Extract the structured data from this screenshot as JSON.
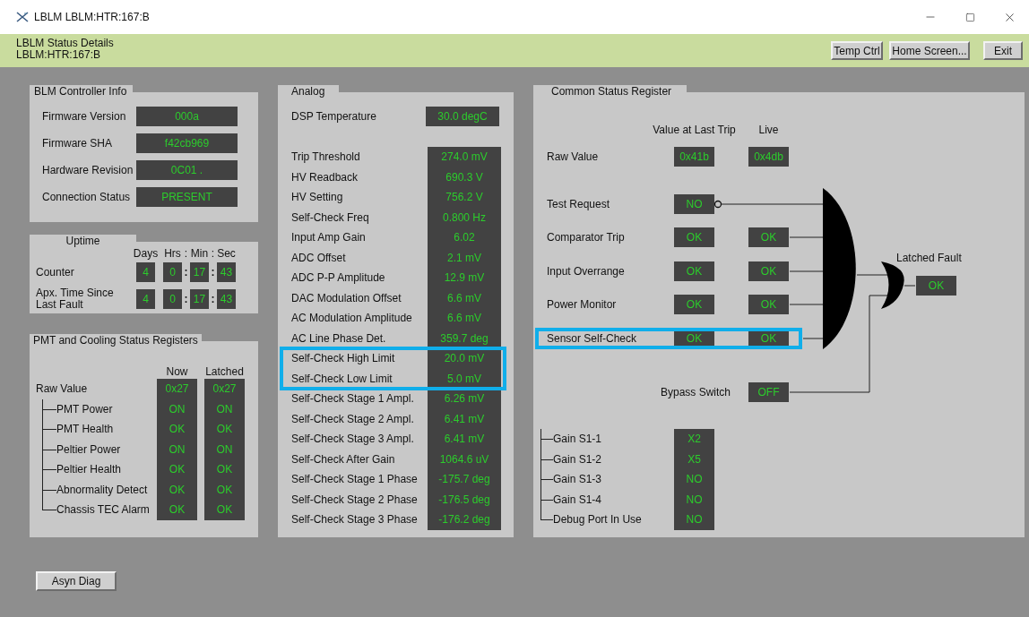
{
  "window": {
    "title": "LBLM LBLM:HTR:167:B"
  },
  "header": {
    "title": "LBLM Status Details",
    "subtitle": "LBLM:HTR:167:B",
    "buttons": [
      "Temp Ctrl",
      "Home Screen...",
      "Exit"
    ]
  },
  "controller_info": {
    "title": "BLM Controller Info",
    "fields": [
      {
        "label": "Firmware Version",
        "value": "000a"
      },
      {
        "label": "Firmware SHA",
        "value": "f42cb969"
      },
      {
        "label": "Hardware Revision",
        "value": "0C01 ."
      },
      {
        "label": "Connection Status",
        "value": "PRESENT"
      }
    ]
  },
  "uptime": {
    "title": "Uptime",
    "columns": [
      {
        "kind": "value",
        "text": "Days"
      },
      {
        "kind": "value",
        "text": "Hrs"
      },
      {
        "kind": "sep",
        "text": ":"
      },
      {
        "kind": "value",
        "text": "Min"
      },
      {
        "kind": "sep",
        "text": ":"
      },
      {
        "kind": "value",
        "text": "Sec"
      }
    ],
    "rows": [
      {
        "label": "Counter",
        "cells": [
          {
            "kind": "value",
            "text": "4"
          },
          {
            "kind": "value",
            "text": "0"
          },
          {
            "kind": "sep",
            "text": ":"
          },
          {
            "kind": "value",
            "text": "17"
          },
          {
            "kind": "sep",
            "text": ":"
          },
          {
            "kind": "value",
            "text": "43"
          }
        ]
      },
      {
        "label": "Apx. Time Since Last Fault",
        "cells": [
          {
            "kind": "value",
            "text": "4"
          },
          {
            "kind": "value",
            "text": "0"
          },
          {
            "kind": "sep",
            "text": ":"
          },
          {
            "kind": "value",
            "text": "17"
          },
          {
            "kind": "sep",
            "text": ":"
          },
          {
            "kind": "value",
            "text": "43"
          }
        ]
      }
    ]
  },
  "pmt": {
    "title": "PMT and Cooling Status Registers",
    "columns": [
      "Now",
      "Latched"
    ],
    "rows": [
      {
        "label": "Raw Value",
        "now": "0x27",
        "latched": "0x27",
        "children": [
          {
            "label": "PMT Power",
            "now": "ON",
            "latched": "ON"
          },
          {
            "label": "PMT Health",
            "now": "OK",
            "latched": "OK"
          },
          {
            "label": "Peltier Power",
            "now": "ON",
            "latched": "ON"
          },
          {
            "label": "Peltier Health",
            "now": "OK",
            "latched": "OK"
          },
          {
            "label": "Abnormality Detect",
            "now": "OK",
            "latched": "OK"
          },
          {
            "label": "Chassis TEC Alarm",
            "now": "OK",
            "latched": "OK"
          }
        ]
      }
    ]
  },
  "analog": {
    "title": "Analog",
    "dsp": {
      "label": "DSP Temperature",
      "value": "30.0 degC"
    },
    "rows": [
      {
        "label": "Trip Threshold",
        "value": "274.0 mV",
        "highlighted": false
      },
      {
        "label": "HV Readback",
        "value": "690.3 V",
        "highlighted": false
      },
      {
        "label": "HV Setting",
        "value": "756.2 V",
        "highlighted": false
      },
      {
        "label": "Self-Check Freq",
        "value": "0.800 Hz",
        "highlighted": false
      },
      {
        "label": "Input Amp Gain",
        "value": "6.02",
        "highlighted": false
      },
      {
        "label": "ADC Offset",
        "value": "2.1 mV",
        "highlighted": false
      },
      {
        "label": "ADC P-P Amplitude",
        "value": "12.9 mV",
        "highlighted": false
      },
      {
        "label": "DAC Modulation Offset",
        "value": "6.6 mV",
        "highlighted": false
      },
      {
        "label": "AC Modulation Amplitude",
        "value": "6.6 mV",
        "highlighted": false
      },
      {
        "label": "AC Line Phase Det.",
        "value": "359.7 deg",
        "highlighted": false
      },
      {
        "label": "Self-Check High Limit",
        "value": "20.0 mV",
        "highlighted": true
      },
      {
        "label": "Self-Check Low Limit",
        "value": "5.0 mV",
        "highlighted": true
      },
      {
        "label": "Self-Check Stage 1 Ampl.",
        "value": "6.26 mV",
        "highlighted": false
      },
      {
        "label": "Self-Check Stage 2 Ampl.",
        "value": "6.41 mV",
        "highlighted": false
      },
      {
        "label": "Self-Check Stage 3 Ampl.",
        "value": "6.41 mV",
        "highlighted": false
      },
      {
        "label": "Self-Check After Gain",
        "value": "1064.6 uV",
        "highlighted": false
      },
      {
        "label": "Self-Check Stage 1 Phase",
        "value": "-175.7 deg",
        "highlighted": false
      },
      {
        "label": "Self-Check Stage 2 Phase",
        "value": "-176.5 deg",
        "highlighted": false
      },
      {
        "label": "Self-Check Stage 3 Phase",
        "value": "-176.2 deg",
        "highlighted": false
      }
    ]
  },
  "common": {
    "title": "Common Status Register",
    "columns": [
      "Value at Last Trip",
      "Live"
    ],
    "rows": [
      {
        "kind": "raw",
        "label": "Raw Value",
        "trip": "0x41b",
        "live": "0x4db",
        "highlighted": false
      },
      {
        "kind": "inverted",
        "label": "Test Request",
        "trip": "NO",
        "highlighted": false
      },
      {
        "kind": "input",
        "label": "Comparator Trip",
        "trip": "OK",
        "live": "OK",
        "highlighted": false
      },
      {
        "kind": "input",
        "label": "Input Overrange",
        "trip": "OK",
        "live": "OK",
        "highlighted": false
      },
      {
        "kind": "input",
        "label": "Power Monitor",
        "trip": "OK",
        "live": "OK",
        "highlighted": false
      },
      {
        "kind": "input",
        "label": "Sensor Self-Check",
        "trip": "OK",
        "live": "OK",
        "highlighted": true
      }
    ],
    "bypass": {
      "label": "Bypass Switch",
      "value": "OFF"
    },
    "latched_fault": {
      "label": "Latched Fault",
      "value": "OK"
    },
    "gains": [
      {
        "label": "Gain S1-1",
        "value": "X2"
      },
      {
        "label": "Gain S1-2",
        "value": "X5"
      },
      {
        "label": "Gain S1-3",
        "value": "NO"
      },
      {
        "label": "Gain S1-4",
        "value": "NO"
      },
      {
        "label": "Debug Port In Use",
        "value": "NO"
      }
    ]
  },
  "footer": {
    "button": "Asyn Diag"
  }
}
